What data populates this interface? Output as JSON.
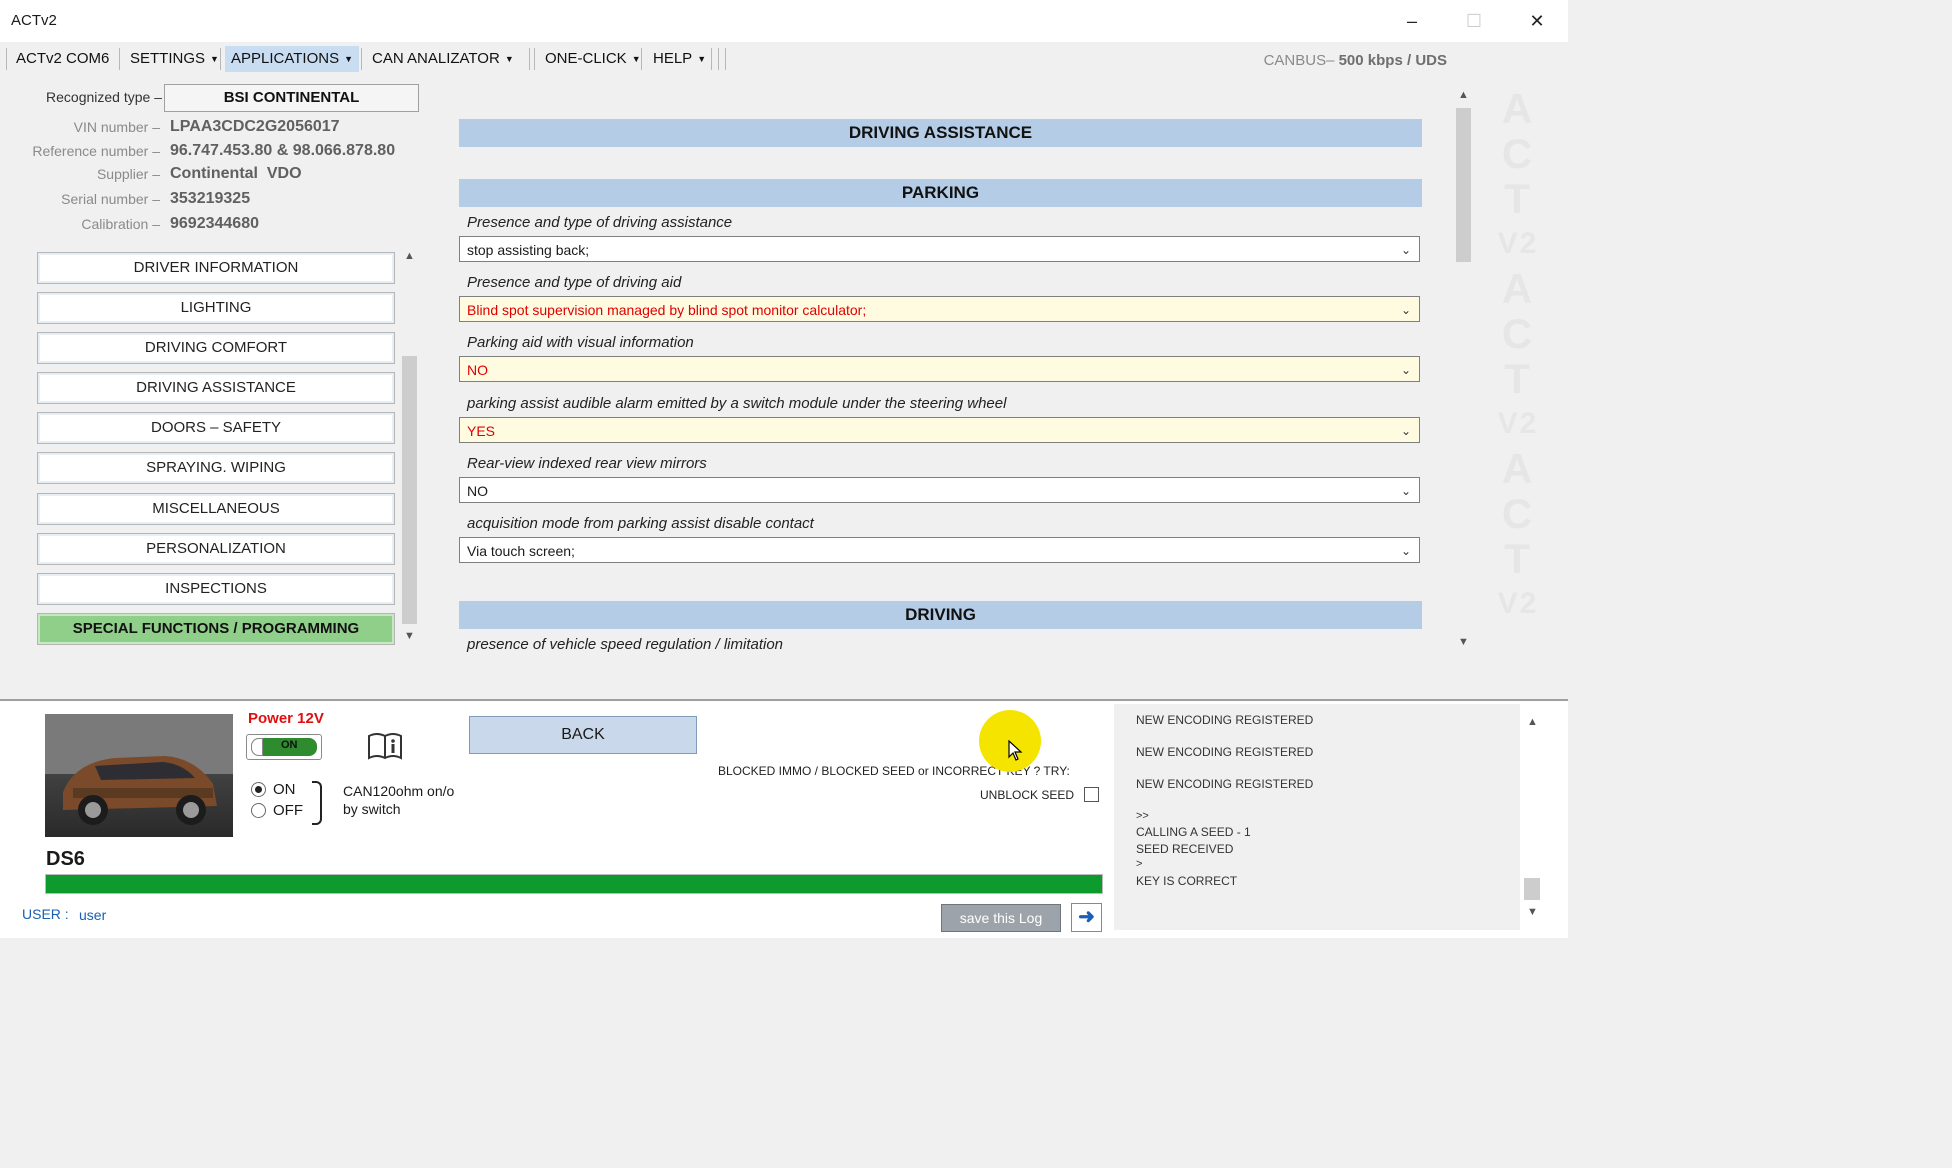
{
  "window": {
    "title": "ACTv2"
  },
  "menu": [
    {
      "label": "ACTv2 COM6",
      "caret": false
    },
    {
      "label": "SETTINGS",
      "caret": true
    },
    {
      "label": "APPLICATIONS",
      "caret": true
    },
    {
      "label": "CAN ANALIZATOR",
      "caret": true
    },
    {
      "label": "ONE-CLICK",
      "caret": true
    },
    {
      "label": "HELP",
      "caret": true
    }
  ],
  "canbus": {
    "prefix": "CANBUS–",
    "speed": "500 kbps",
    "slash": "/",
    "protocol": "UDS"
  },
  "info": {
    "recognized_label": "Recognized type –",
    "recognized_value": "BSI CONTINENTAL",
    "rows": [
      {
        "label": "VIN number –",
        "value": "LPAA3CDC2G2056017"
      },
      {
        "label": "Reference number –",
        "value": "96.747.453.80 & 98.066.878.80"
      },
      {
        "label": "Supplier –",
        "value": "Continental  VDO"
      },
      {
        "label": "Serial number –",
        "value": "353219325"
      },
      {
        "label": "Calibration –",
        "value": "9692344680"
      }
    ]
  },
  "nav": [
    "DRIVER INFORMATION",
    "LIGHTING",
    "DRIVING COMFORT",
    "DRIVING ASSISTANCE",
    "DOORS – SAFETY",
    "SPRAYING. WIPING",
    "MISCELLANEOUS",
    "PERSONALIZATION",
    "INSPECTIONS",
    "SPECIAL FUNCTIONS / PROGRAMMING"
  ],
  "main": {
    "section_title": "DRIVING ASSISTANCE",
    "parking_title": "PARKING",
    "fields": [
      {
        "label": "Presence and type of driving assistance",
        "value": "stop assisting back;",
        "highlight": false
      },
      {
        "label": "Presence and type of driving aid",
        "value": "Blind spot supervision managed by blind spot monitor calculator;",
        "highlight": true
      },
      {
        "label": "Parking aid with visual information",
        "value": "NO",
        "highlight": true
      },
      {
        "label": "parking assist audible alarm emitted by a switch module under the steering wheel",
        "value": "YES",
        "highlight": true
      },
      {
        "label": "Rear-view indexed rear view mirrors",
        "value": "NO",
        "highlight": false
      },
      {
        "label": "acquisition mode from parking assist disable contact",
        "value": "Via touch screen;",
        "highlight": false
      }
    ],
    "driving_title": "DRIVING",
    "driving_first_label": "presence of vehicle speed regulation / limitation"
  },
  "watermark": [
    "A",
    "C",
    "T",
    "V2",
    "A",
    "C",
    "T",
    "V2",
    "A",
    "C",
    "T",
    "V2"
  ],
  "bottom": {
    "power_label": "Power 12V",
    "power_toggle": "ON",
    "radio_on": "ON",
    "radio_off": "OFF",
    "can_line1": "CAN120ohm on/o",
    "can_line2": "by switch",
    "vehicle": "DS6",
    "back_button": "BACK",
    "blocked_text": "BLOCKED IMMO / BLOCKED SEED or INCORRECT KEY ? TRY:",
    "unblock_label": "UNBLOCK SEED",
    "user_label": "USER :",
    "user_value": "user",
    "save_log": "save this Log",
    "progress": 1.0
  },
  "log": [
    "NEW ENCODING REGISTERED",
    "NEW ENCODING REGISTERED",
    "NEW ENCODING REGISTERED",
    ">>",
    "CALLING A SEED - 1",
    "SEED RECEIVED",
    ">",
    "KEY IS CORRECT"
  ],
  "colors": {
    "band": "#b5cce6",
    "highlight_bg": "#fffbe0",
    "highlight_text": "#e00000",
    "special": "#8fcf8a",
    "progress": "#0e9b2e",
    "power": "#e01010",
    "cursor_dot": "#f5e400"
  }
}
